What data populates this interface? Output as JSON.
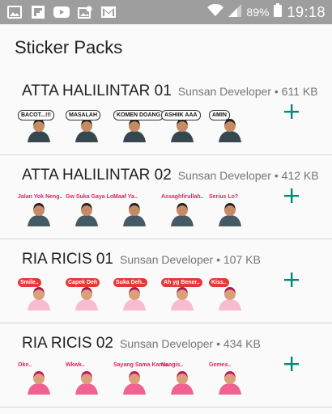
{
  "status_bar": {
    "battery": "89%",
    "time": "19:18",
    "icons": [
      "image-icon",
      "flipboard-icon",
      "youtube-icon",
      "photo-icon",
      "gmail-icon",
      "wifi-icon",
      "signal-icon",
      "battery-icon"
    ]
  },
  "app": {
    "title": "Sticker Packs"
  },
  "packs": [
    {
      "name": "ATTA HALILINTAR 01",
      "publisher": "Sunsan Developer",
      "size": "611 KB",
      "stickers": [
        "BACOT...!!!",
        "MASALAH",
        "KOMEN DOANG",
        "ASHIIK AAA",
        "AMIN"
      ]
    },
    {
      "name": "ATTA HALILINTAR 02",
      "publisher": "Sunsan Developer",
      "size": "412 KB",
      "stickers": [
        "Jalan Yok Neng..",
        "Gw Suka Gaya Lo..",
        "Maaf Ya..",
        "Assaghfirullah..",
        "Serius Lo?"
      ]
    },
    {
      "name": "RIA RICIS 01",
      "publisher": "Sunsan Developer",
      "size": "107 KB",
      "stickers": [
        "Smile..",
        "Capek Deh",
        "Suka Deh..",
        "Ah yg Bener..",
        "Kiss.."
      ]
    },
    {
      "name": "RIA RICIS 02",
      "publisher": "Sunsan Developer",
      "size": "434 KB",
      "stickers": [
        "Oke..",
        "Wkwk..",
        "Sayang Sama Kamu..",
        "Nangis..",
        "Gemes.."
      ]
    }
  ],
  "colors": {
    "accent": "#00897b",
    "status_bar": "#9e9e9e",
    "divider": "#d7d7d7"
  }
}
